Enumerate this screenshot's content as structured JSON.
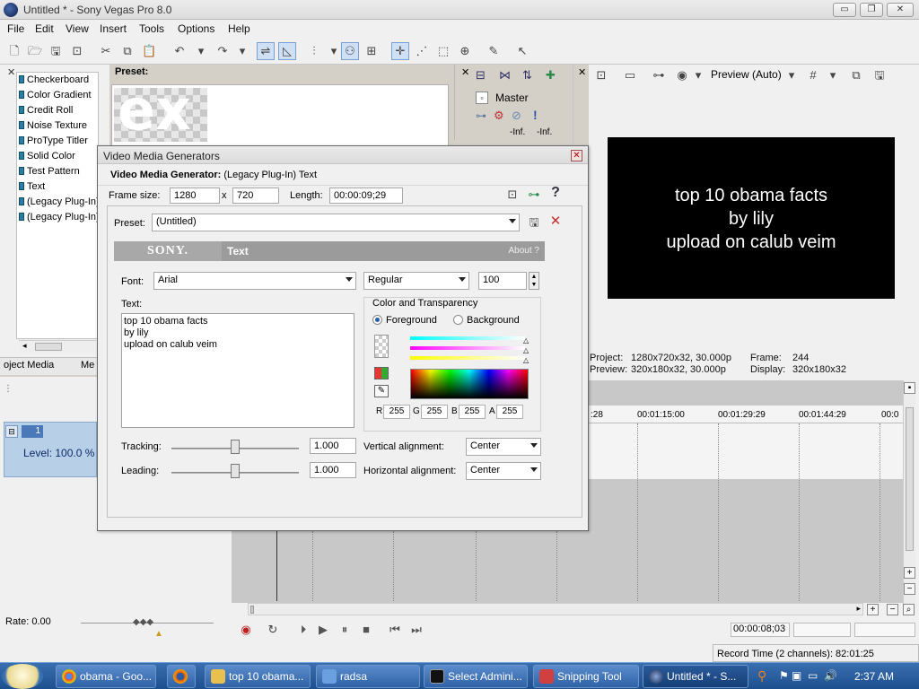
{
  "window": {
    "title": "Untitled * - Sony Vegas Pro 8.0",
    "minimize": "▭",
    "maximize": "❐",
    "close": "✕"
  },
  "menu": [
    "File",
    "Edit",
    "View",
    "Insert",
    "Tools",
    "Options",
    "Help"
  ],
  "generators": {
    "items": [
      "Checkerboard",
      "Color Gradient",
      "Credit Roll",
      "Noise Texture",
      "ProType Titler",
      "Solid Color",
      "Test Pattern",
      "Text",
      "(Legacy Plug-In)",
      "(Legacy Plug-In)"
    ],
    "preset_label": "Preset:",
    "thumb_text": "ex",
    "tabs": [
      "oject Media",
      "Me"
    ]
  },
  "mixer": {
    "master_label": "Master",
    "left_inf": "-Inf.",
    "right_inf": "-Inf."
  },
  "preview": {
    "mode_label": "Preview (Auto)",
    "screen_lines": [
      "top 10 obama facts",
      "by lily",
      "upload on calub veim"
    ],
    "project_label": "Project:",
    "project_value": "1280x720x32, 30.000p",
    "preview_label": "Preview:",
    "preview_value": "320x180x32, 30.000p",
    "frame_label": "Frame:",
    "frame_value": "244",
    "display_label": "Display:",
    "display_value": "320x180x32"
  },
  "timeline": {
    "ruler_ticks": [
      ":28",
      "00:01:15:00",
      "00:01:29:29",
      "00:01:44:29",
      "00:0"
    ],
    "level": "Level: 100.0 %",
    "track_number": "1",
    "rate": "Rate: 0.00",
    "timecode": "00:00:08;03",
    "record_time": "Record Time (2 channels): 82:01:25"
  },
  "dialog": {
    "title": "Video Media Generators",
    "header_bold": "Video Media Generator:",
    "header_rest": " (Legacy Plug-In) Text",
    "frame_size_label": "Frame size:",
    "frame_width": "1280",
    "x_label": "x",
    "frame_height": "720",
    "length_label": "Length:",
    "length_value": "00:00:09;29",
    "preset_label": "Preset:",
    "preset_value": "(Untitled)",
    "sony_logo": "SONY.",
    "sony_plugin": "Text",
    "about": "About  ?",
    "font_label": "Font:",
    "font_value": "Arial",
    "style_value": "Regular",
    "size_value": "100",
    "text_label": "Text:",
    "text_value": "top 10 obama facts\nby lily\nupload on calub veim",
    "color_group": "Color and Transparency",
    "foreground": "Foreground",
    "background": "Background",
    "r_label": "R",
    "r_value": "255",
    "g_label": "G",
    "g_value": "255",
    "b_label": "B",
    "b_value": "255",
    "a_label": "A",
    "a_value": "255",
    "tracking_label": "Tracking:",
    "tracking_value": "1.000",
    "leading_label": "Leading:",
    "leading_value": "1.000",
    "valign_label": "Vertical alignment:",
    "valign_value": "Center",
    "halign_label": "Horizontal alignment:",
    "halign_value": "Center"
  },
  "taskbar": {
    "buttons": [
      "obama - Goo...",
      "top 10 obama...",
      "radsa",
      "Select Admini...",
      "Snipping Tool",
      "Untitled * - S..."
    ],
    "clock": "2:37 AM"
  },
  "colors": {
    "dialog_bg": "#f0f0f0",
    "sony_bar": "#9b9b9b",
    "preview_bg": "#000000",
    "taskbar": "#1d4f8e"
  }
}
